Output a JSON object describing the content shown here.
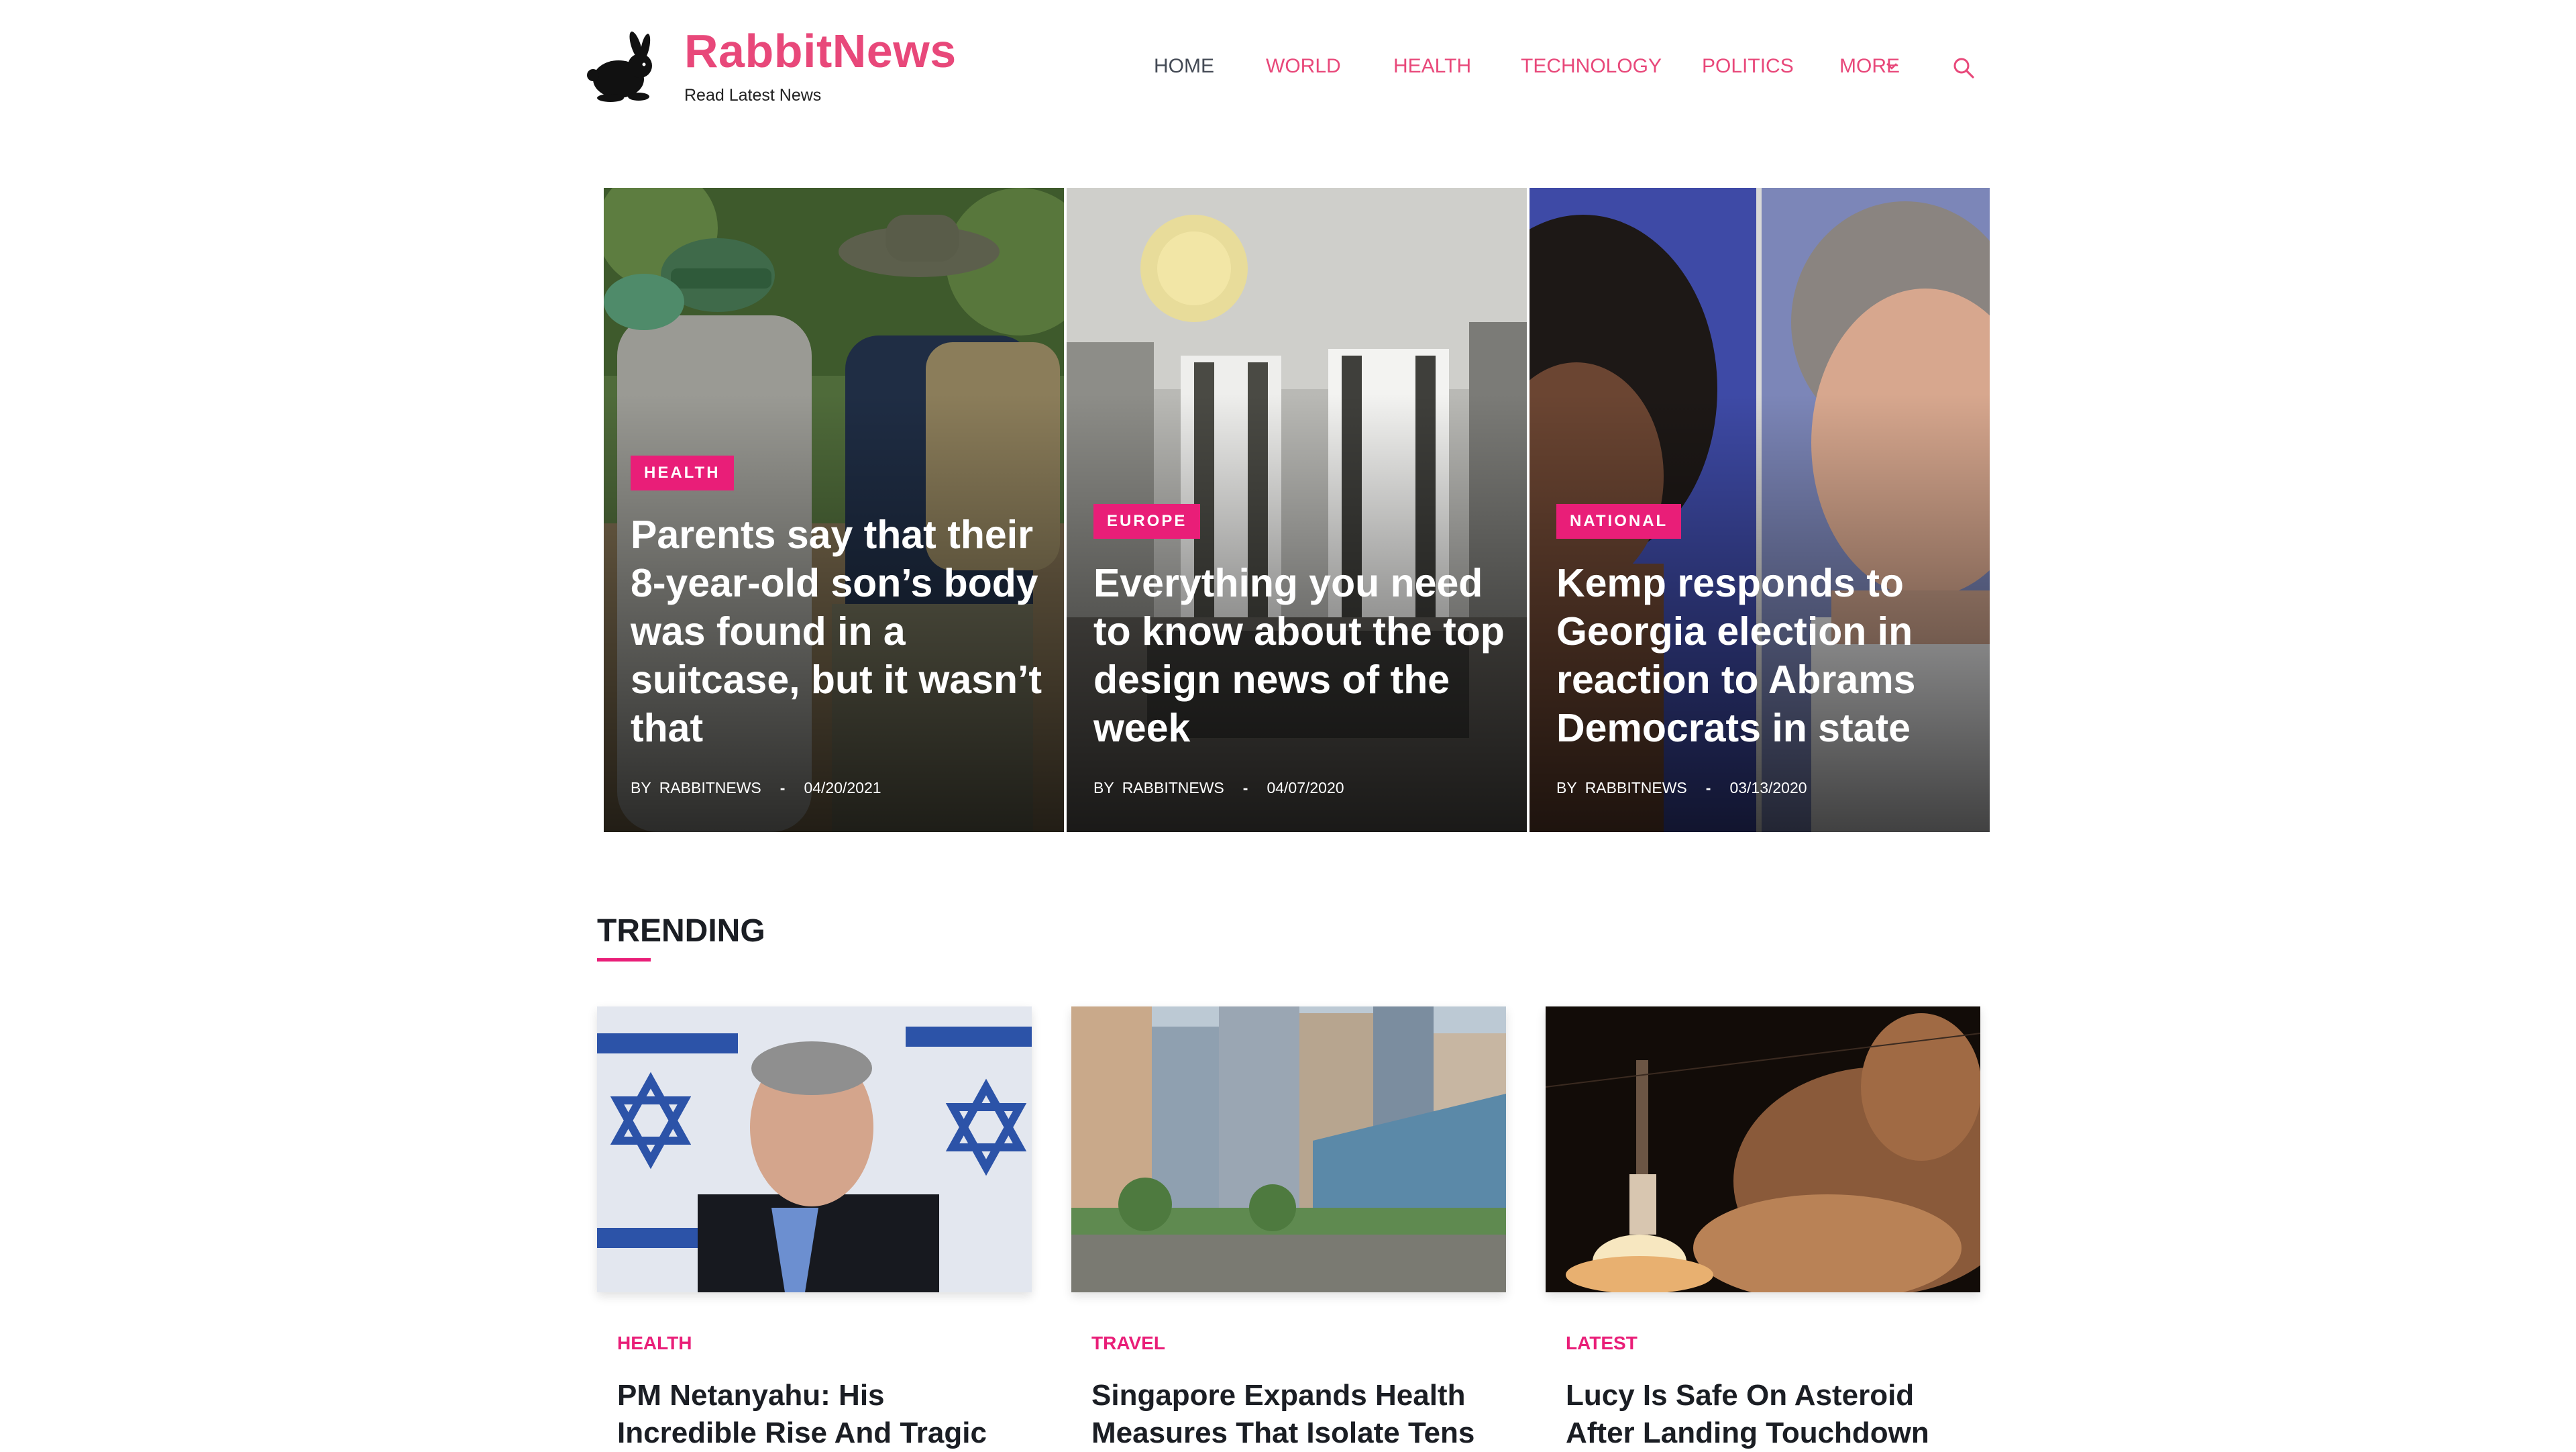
{
  "brand": {
    "title": "RabbitNews",
    "tagline": "Read Latest News",
    "accent": "#e91e78",
    "logo_color": "#e8487a"
  },
  "nav": {
    "items": [
      {
        "label": "HOME",
        "active": true
      },
      {
        "label": "WORLD"
      },
      {
        "label": "HEALTH"
      },
      {
        "label": "TECHNOLOGY"
      },
      {
        "label": "POLITICS"
      },
      {
        "label": "MORE",
        "has_dropdown": true
      }
    ],
    "search_icon": "search-icon"
  },
  "hero": [
    {
      "category": "HEALTH",
      "title": "Parents say that their 8-year-old son’s body was found in a suitcase, but it wasn’t that",
      "by": "BY",
      "author": "RABBITNEWS",
      "sep": "-",
      "date": "04/20/2021"
    },
    {
      "category": "EUROPE",
      "title": "Everything you need to know about the top design news of the week",
      "by": "BY",
      "author": "RABBITNEWS",
      "sep": "-",
      "date": "04/07/2020"
    },
    {
      "category": "NATIONAL",
      "title": "Kemp responds to Georgia election in reaction to Abrams Democrats in state",
      "by": "BY",
      "author": "RABBITNEWS",
      "sep": "-",
      "date": "03/13/2020"
    }
  ],
  "trending": {
    "heading": "TRENDING",
    "items": [
      {
        "category": "HEALTH",
        "title": "PM Netanyahu: His Incredible Rise And Tragic"
      },
      {
        "category": "TRAVEL",
        "title": "Singapore Expands Health Measures That Isolate Tens"
      },
      {
        "category": "LATEST",
        "title": "Lucy Is Safe On Asteroid After Landing Touchdown"
      }
    ]
  }
}
